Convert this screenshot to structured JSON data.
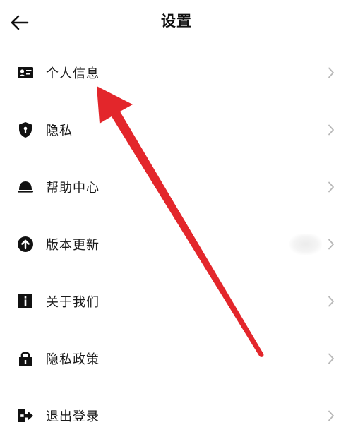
{
  "header": {
    "title": "设置",
    "back_icon": "arrow-left-icon"
  },
  "menu": {
    "items": [
      {
        "label": "个人信息",
        "icon": "id-card-icon"
      },
      {
        "label": "隐私",
        "icon": "shield-icon"
      },
      {
        "label": "帮助中心",
        "icon": "bell-icon"
      },
      {
        "label": "版本更新",
        "icon": "arrow-up-circle-icon"
      },
      {
        "label": "关于我们",
        "icon": "info-icon"
      },
      {
        "label": "隐私政策",
        "icon": "lock-icon"
      },
      {
        "label": "退出登录",
        "icon": "logout-icon"
      }
    ]
  },
  "colors": {
    "text": "#111111",
    "chevron": "#b8b8b8",
    "annotation_arrow": "#e3262b"
  }
}
